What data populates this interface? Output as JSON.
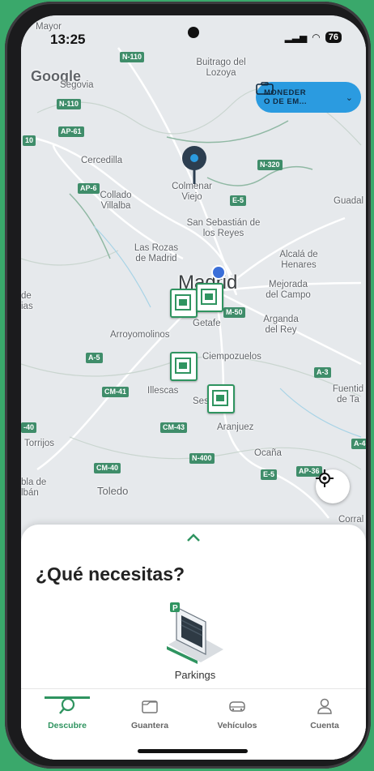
{
  "status_bar": {
    "time": "13:25",
    "battery": "76"
  },
  "map": {
    "provider_logo": "Google",
    "wallet_button": {
      "label_line1": "MONEDER",
      "label_line2": "O DE EM...",
      "icon": "wallet-icon"
    },
    "towns": {
      "mayor": "Mayor",
      "buitrago": "Buitrago del Lozoya",
      "segovia": "Segovia",
      "cercedilla": "Cercedilla",
      "collado": "Collado Villalba",
      "colmenar": "Colmenar Viejo",
      "sansebastian": "San Sebastián de los Reyes",
      "guadalajara": "Guadal",
      "lasrozas": "Las Rozas de Madrid",
      "alcala": "Alcalá de Henares",
      "madrid": "Madrid",
      "mejorada": "Mejorada del Campo",
      "arganda": "Arganda del Rey",
      "getafe": "Getafe",
      "arroyomolinos": "Arroyomolinos",
      "ciempozuelos": "Ciempozuelos",
      "illescas": "Illescas",
      "sesena": "Seseña",
      "aranjuez": "Aranjuez",
      "fuentidueña": "Fuentid de Ta",
      "torrijos": "Torrijos",
      "ocana": "Ocaña",
      "toledo": "Toledo",
      "puebla": "bla de lbán",
      "corral": "Corral",
      "de_ias": "de ias"
    },
    "roads": {
      "n110a": "N-110",
      "n110b": "N-110",
      "ap61": "AP-61",
      "ap6": "AP-6",
      "n320": "N-320",
      "e5a": "E-5",
      "a5": "A-5",
      "m50": "M-50",
      "cm41": "CM-41",
      "cm43": "CM-43",
      "a3": "A-3",
      "n400": "N-400",
      "cm40": "CM-40",
      "e5b": "E-5",
      "ap36": "AP-36",
      "a40": "-40",
      "a4": "A-4",
      "m10": "10"
    }
  },
  "sheet": {
    "title": "¿Qué necesitas?",
    "services": [
      {
        "label": "Parkings",
        "icon": "parking-illustration-icon"
      }
    ]
  },
  "nav": {
    "items": [
      {
        "label": "Descubre",
        "icon": "search-icon",
        "active": true
      },
      {
        "label": "Guantera",
        "icon": "glovebox-icon",
        "active": false
      },
      {
        "label": "Vehículos",
        "icon": "car-icon",
        "active": false
      },
      {
        "label": "Cuenta",
        "icon": "user-icon",
        "active": false
      }
    ]
  },
  "colors": {
    "accent": "#2f9460",
    "wallet": "#2b9be0",
    "map_bg": "#e6e9ec"
  }
}
